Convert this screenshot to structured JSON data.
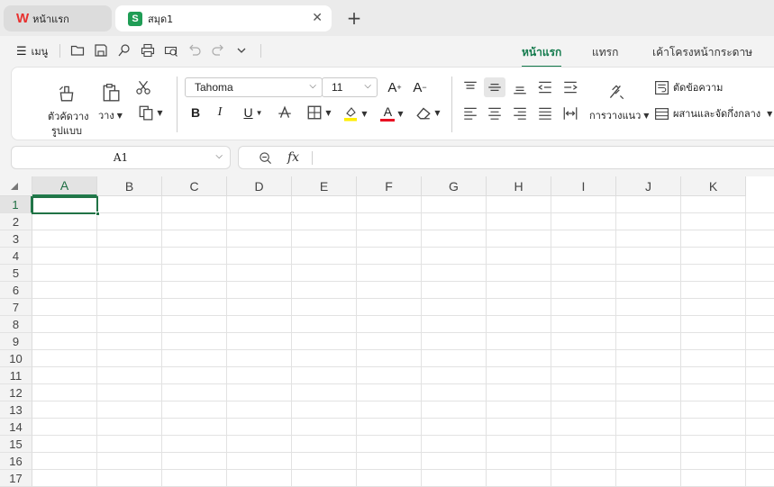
{
  "tabs": [
    {
      "label": "หน้าแรก",
      "logo": "W"
    },
    {
      "label": "สมุด1",
      "logo": "S"
    }
  ],
  "menu": {
    "menu_label": "เมนู",
    "ribbon_tabs": [
      "หน้าแรก",
      "แทรก",
      "เค้าโครงหน้ากระดาษ"
    ]
  },
  "ribbon": {
    "format_painter_line1": "ตัวคัดวาง",
    "format_painter_line2": "รูปแบบ",
    "paste_label": "วาง",
    "font_name": "Tahoma",
    "font_size": "11",
    "orientation_label": "การวางแนว",
    "wrap_text_label": "ตัดข้อความ",
    "merge_label": "ผสานและจัดกึ่งกลาง",
    "bold": "B",
    "italic": "I",
    "underline": "U",
    "font_color_letter": "A",
    "grow_font": "A",
    "shrink_font": "A"
  },
  "colors": {
    "accent": "#127a4c",
    "highlight": "#ffee00",
    "font_color": "#e81123",
    "selection": "#217346"
  },
  "formula_bar": {
    "cell_ref": "A1",
    "fx": "fx"
  },
  "sheet": {
    "columns": [
      "A",
      "B",
      "C",
      "D",
      "E",
      "F",
      "G",
      "H",
      "I",
      "J",
      "K"
    ],
    "rows": [
      "1",
      "2",
      "3",
      "4",
      "5",
      "6",
      "7",
      "8",
      "9",
      "10",
      "11",
      "12",
      "13",
      "14",
      "15",
      "16",
      "17"
    ],
    "selected_cell": "A1"
  }
}
